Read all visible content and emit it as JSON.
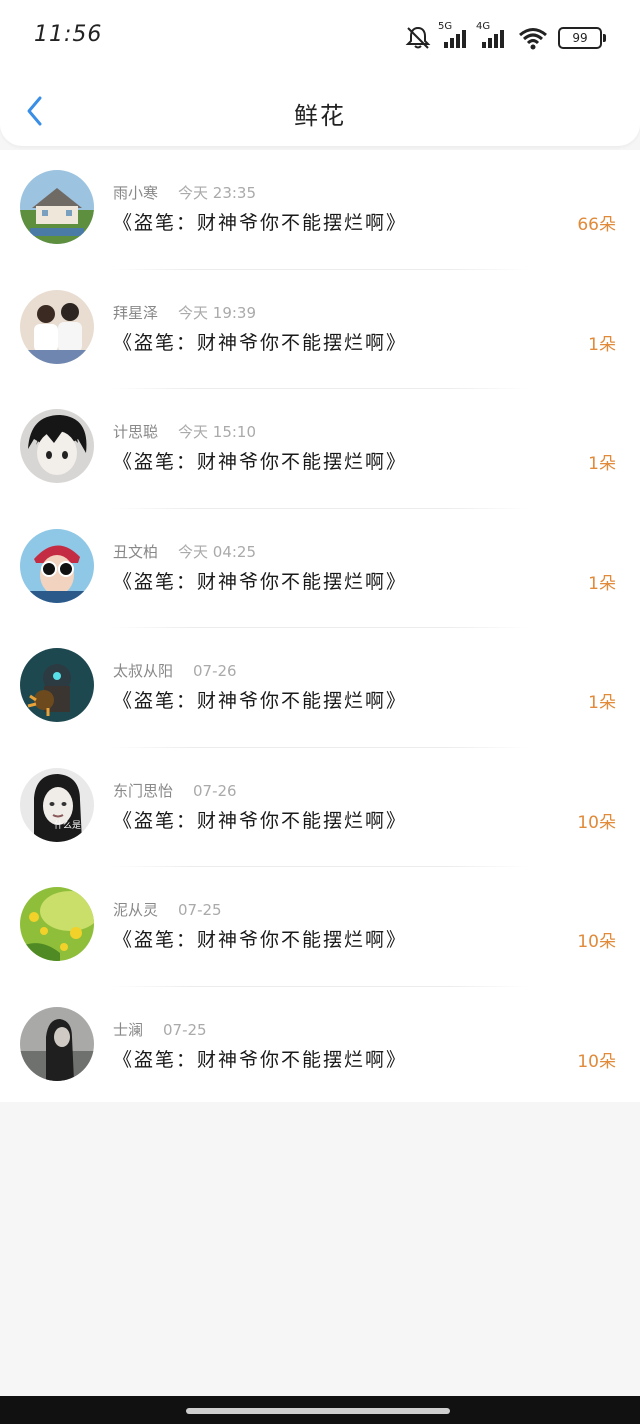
{
  "status_bar": {
    "time": "11:56",
    "network_1": "5G",
    "network_2": "4G",
    "battery": "99",
    "icons": [
      "mute-notification-icon",
      "signal-5g-icon",
      "signal-4g-icon",
      "wifi-icon",
      "battery-icon"
    ]
  },
  "header": {
    "title": "鲜花",
    "back_icon": "back-chevron-icon"
  },
  "colors": {
    "accent": "#3a8ee6",
    "count": "#e08a3a",
    "name": "#888888",
    "time": "#aaaaaa",
    "background": "#f6f6f6"
  },
  "records": [
    {
      "name": "雨小寒",
      "time": "今天 23:35",
      "book": "《盗笔：财神爷你不能摆烂啊》",
      "count": "66朵"
    },
    {
      "name": "拜星泽",
      "time": "今天 19:39",
      "book": "《盗笔：财神爷你不能摆烂啊》",
      "count": "1朵"
    },
    {
      "name": "计思聪",
      "time": "今天 15:10",
      "book": "《盗笔：财神爷你不能摆烂啊》",
      "count": "1朵"
    },
    {
      "name": "丑文柏",
      "time": "今天 04:25",
      "book": "《盗笔：财神爷你不能摆烂啊》",
      "count": "1朵"
    },
    {
      "name": "太叔从阳",
      "time": "07-26",
      "book": "《盗笔：财神爷你不能摆烂啊》",
      "count": "1朵"
    },
    {
      "name": "东门思怡",
      "time": "07-26",
      "book": "《盗笔：财神爷你不能摆烂啊》",
      "count": "10朵"
    },
    {
      "name": "泥从灵",
      "time": "07-25",
      "book": "《盗笔：财神爷你不能摆烂啊》",
      "count": "10朵"
    },
    {
      "name": "士澜",
      "time": "07-25",
      "book": "《盗笔：财神爷你不能摆烂啊》",
      "count": "10朵"
    }
  ],
  "avatar_overlay_text": "什么是"
}
